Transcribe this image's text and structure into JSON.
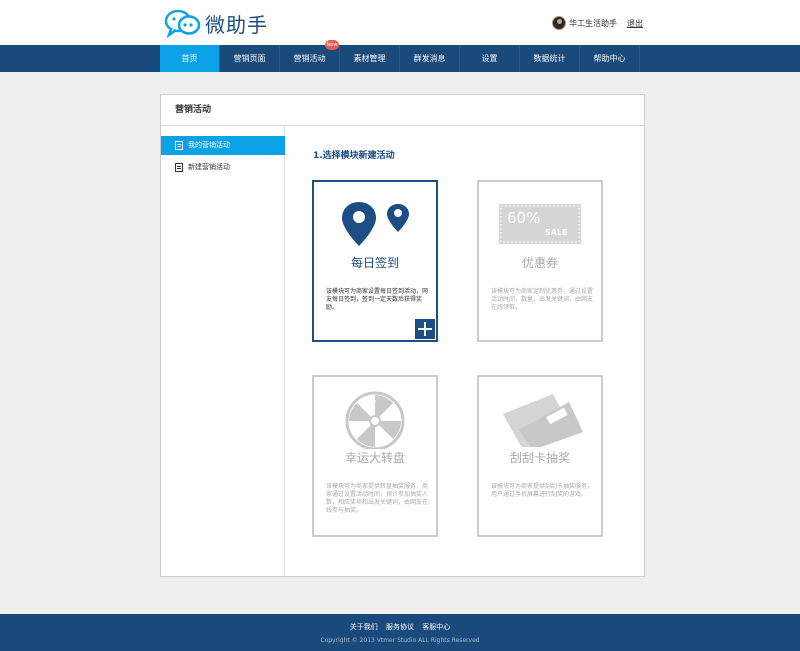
{
  "app": {
    "name": "微助手"
  },
  "user": {
    "name": "华工生活助手",
    "logout": "退出"
  },
  "nav": {
    "items": [
      "首页",
      "营销页面",
      "营销活动",
      "素材管理",
      "群发消息",
      "设置",
      "数据统计",
      "帮助中心"
    ],
    "badge": "New",
    "active_index": 0
  },
  "panel": {
    "title": "营销活动",
    "sidebar": [
      "我的营销活动",
      "新建营销活动"
    ],
    "content_title": "1.选择模块新建活动"
  },
  "cards": [
    {
      "title": "每日签到",
      "desc": "该模块可为商家设置每日签到活动，网友每日签到，签到一定天数后获得奖励。",
      "icon": "map-pin-icon"
    },
    {
      "title": "优惠券",
      "desc": "该模块可为商家定制优惠券，通过设置活动时间，数量，出发关键词，由网友在线领取。",
      "icon": "coupon-icon",
      "coupon_pct": "60%",
      "coupon_sale": "SALE"
    },
    {
      "title": "幸运大转盘",
      "desc": "该模块可为商家提供转盘抽奖服务，商家通过设置活动时间，预计参加抽奖人数，相应奖项和出发关键词，由网友在线参与抽奖。",
      "icon": "wheel-icon"
    },
    {
      "title": "刮刮卡抽奖",
      "desc": "该模块可为商家提供刮刮卡抽奖服务，用户通过手机屏幕进行刮奖的游戏。",
      "icon": "scratch-card-icon"
    }
  ],
  "footer": {
    "links": [
      "关于我们",
      "服务协议",
      "客服中心"
    ],
    "copyright": "Copyright © 2013 Vtmer Studio ALL Rights Reserved"
  },
  "colors": {
    "primary": "#1a4a7c",
    "accent": "#0ca2e8",
    "brand": "#1c4d84",
    "new_badge": "#e85a4f"
  }
}
